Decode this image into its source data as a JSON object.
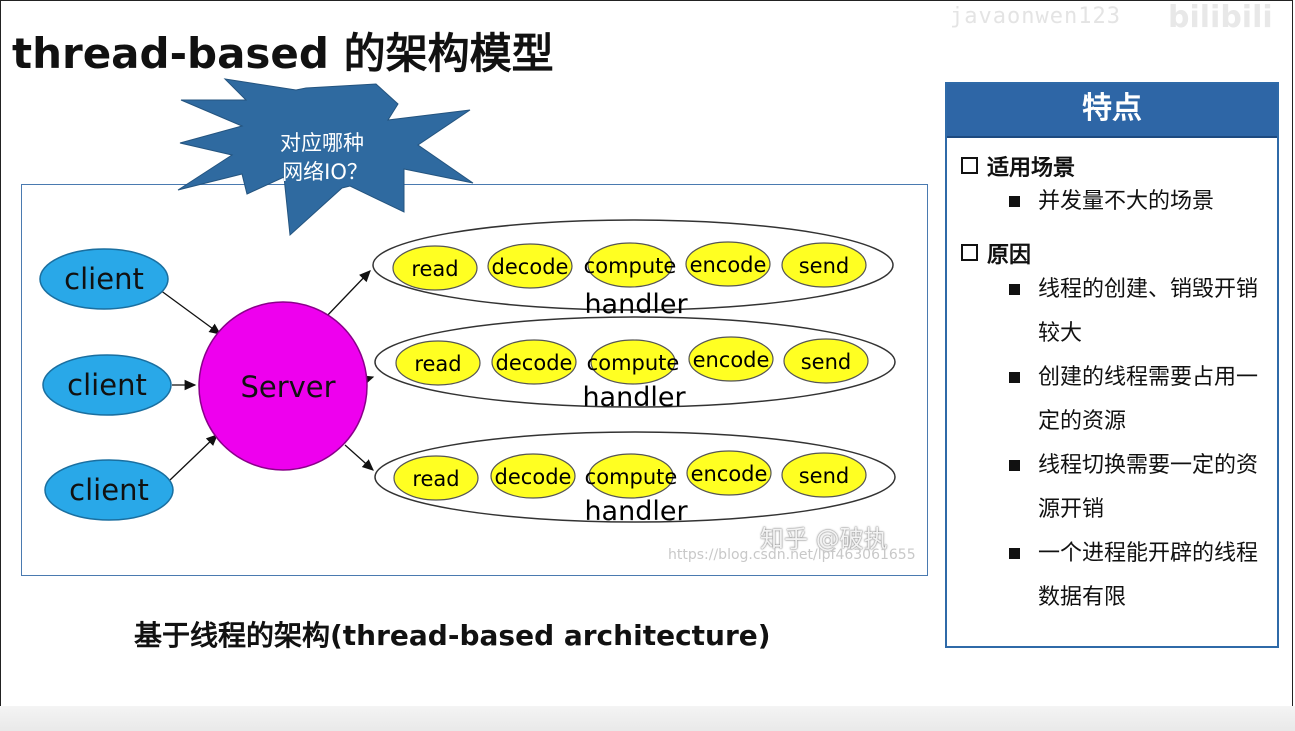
{
  "title": "thread-based 的架构模型",
  "callout": {
    "line1": "对应哪种",
    "line2": "网络IO？"
  },
  "diagram": {
    "clients": [
      "client",
      "client",
      "client"
    ],
    "server": "Server",
    "handler_label": "handler",
    "handler_steps": [
      "read",
      "decode",
      "compute",
      "encode",
      "send"
    ],
    "colors": {
      "client": "#29a8e8",
      "server": "#ee00ee",
      "step": "#ffff22",
      "frame": "#4a7ab0"
    }
  },
  "caption": "基于线程的架构(thread-based architecture)",
  "panel": {
    "header": "特点",
    "sections": [
      {
        "title": "适用场景",
        "items": [
          "并发量不大的场景"
        ]
      },
      {
        "title": "原因",
        "items": [
          "线程的创建、销毁开销较大",
          "创建的线程需要占用一定的资源",
          "线程切换需要一定的资源开销",
          "一个进程能开辟的线程数据有限"
        ]
      }
    ],
    "colors": {
      "header_bg": "#2e66a6",
      "border": "#2f6aa8"
    }
  },
  "watermarks": {
    "zhihu": "知乎 @破执",
    "csdn": "https://blog.csdn.net/lpf463061655",
    "uploader": "javaonwen123",
    "bilibili": "bilibili"
  }
}
